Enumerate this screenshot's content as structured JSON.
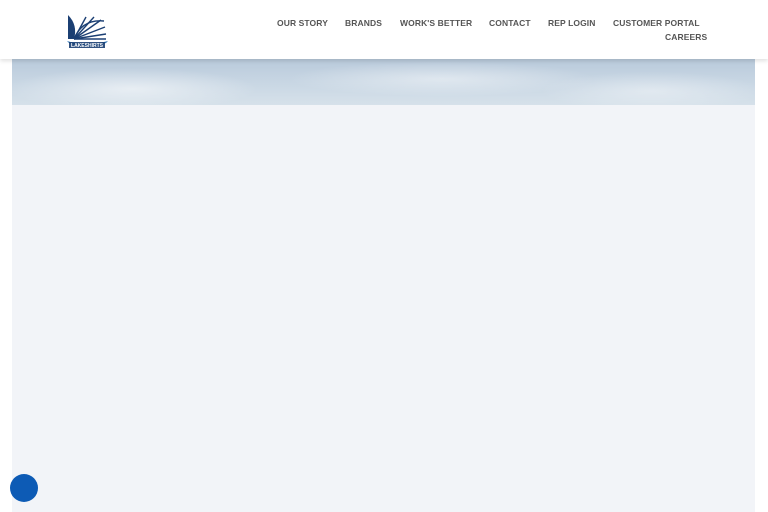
{
  "header": {
    "logo": {
      "icon": "sailboat-logo-icon",
      "alt": "LAKESHIRTS",
      "colors": [
        "#1b3f73",
        "#2e77b8"
      ]
    },
    "nav": {
      "our_story": "OUR STORY",
      "brands": "BRANDS",
      "works_better": "WORK'S BETTER",
      "contact": "CONTACT",
      "rep_login": "REP LOGIN",
      "customer_portal": "CUSTOMER PORTAL",
      "careers": "CAREERS"
    }
  },
  "hero": {
    "description": "sky-banner"
  },
  "chat": {
    "icon": "chat-bubble-icon",
    "color": "#0d5bb5"
  },
  "colors": {
    "nav_text": "#555555",
    "content_bg": "#f2f4f8",
    "accent": "#0d5bb5"
  }
}
